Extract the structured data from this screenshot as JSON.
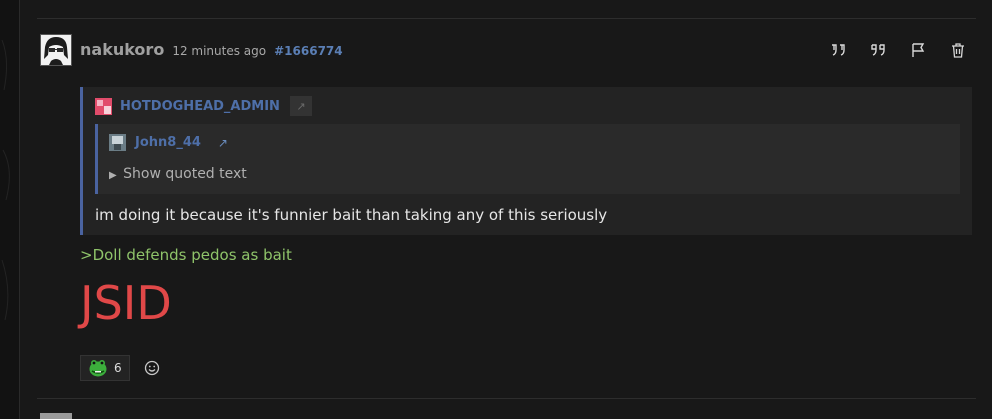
{
  "post": {
    "username": "nakukoro",
    "timestamp": "12 minutes ago",
    "post_id": "#1666774",
    "actions": [
      {
        "icon": "reply-quote-icon"
      },
      {
        "icon": "quote-icon"
      },
      {
        "icon": "flag-icon"
      },
      {
        "icon": "trash-icon"
      }
    ]
  },
  "quote": {
    "username": "HOTDOGHEAD_ADMIN",
    "link_glyph": "↗",
    "text": "im doing it because it's funnier bait than taking any of this seriously",
    "nested": {
      "username": "John8_44",
      "link_glyph": "↗",
      "toggle_glyph": "▶",
      "toggle_label": "Show quoted text"
    }
  },
  "body": {
    "greentext": ">Doll defends pedos as bait",
    "big_text": "JSID"
  },
  "reactions": {
    "items": [
      {
        "icon": "frog-emoji-icon",
        "count": "6"
      }
    ],
    "add_icon": "add-reaction-icon"
  },
  "colors": {
    "accent_blue": "#4e6fa8",
    "greentext": "#8fc46a",
    "red": "#e04848"
  }
}
